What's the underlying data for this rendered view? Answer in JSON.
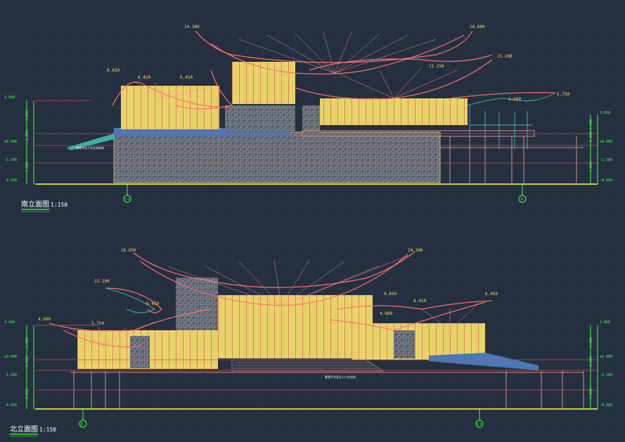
{
  "colors": {
    "background": "#243040",
    "grid": "#2c394a",
    "roof_line": "#ff6f6f",
    "window_fill": "#ffe87a",
    "structure": "#d98a8a",
    "stone": "#8d8d8d",
    "teal": "#3bb1a8",
    "dimension": "#44ff44",
    "ground_line": "#ffff3a",
    "ramp": "#4a78b8",
    "label": "#ffd84a"
  },
  "south_elevation": {
    "title": "南立面图",
    "scale": "1:150",
    "elevations": [
      "14.300",
      "16.600",
      "15.200",
      "11.250",
      "9.650",
      "8.450",
      "6.450",
      "4.600",
      "5.750"
    ],
    "dim_left": [
      "3.800",
      "1.000",
      "7.600"
    ],
    "dim_right": [
      "3.800",
      "1.000",
      "7.600"
    ],
    "level_marks_left": [
      "3.600",
      "±0.000",
      "-1.500",
      "-4.050"
    ],
    "level_marks_right": [
      "3.600",
      "±0.000",
      "-1.500",
      "-4.050"
    ],
    "axes": [
      "1-4",
      "D"
    ],
    "note": "景观平台下为主体结构"
  },
  "north_elevation": {
    "title": "北立面图",
    "scale": "1:150",
    "elevations": [
      "16.650",
      "14.300",
      "15.200",
      "6.450",
      "9.650",
      "8.450",
      "6.450",
      "4.600",
      "5.750",
      "4.600"
    ],
    "dim_left": [
      "3.800",
      "1.000",
      "7.600"
    ],
    "dim_right": [
      "3.800",
      "1.000",
      "7.600"
    ],
    "level_marks_left": [
      "3.600",
      "±0.000",
      "-1.500",
      "-4.050"
    ],
    "level_marks_right": [
      "3.600",
      "±0.000",
      "-1.500",
      "-4.050"
    ],
    "axes": [
      "D",
      "1-4"
    ],
    "note": "景观平台及主入口大台阶"
  }
}
